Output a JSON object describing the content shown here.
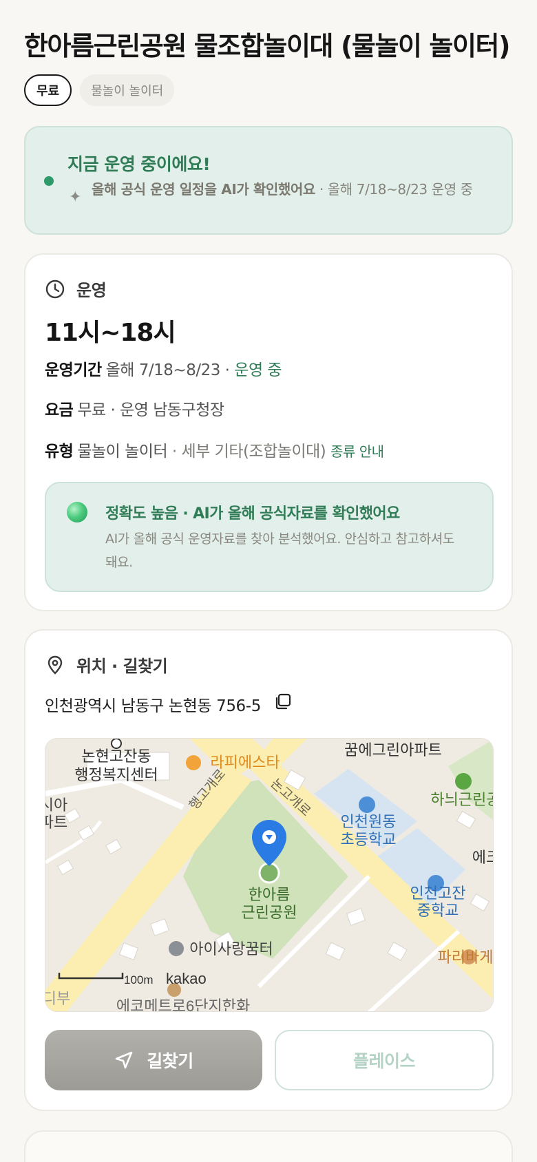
{
  "page": {
    "title": "한아름근린공원 물조합놀이대 (물놀이 놀이터)",
    "tags": [
      "무료",
      "물놀이 놀이터"
    ]
  },
  "status": {
    "title": "지금 운영 중이에요!",
    "ai_note_bold": "올해 공식 운영 일정을 AI가 확인했어요",
    "ai_note_rest": " · 올해 7/18~8/23 운영 중"
  },
  "operation": {
    "section_label": "운영",
    "hours": "11시~18시",
    "period_key": "운영기간",
    "period_value": "올해 7/18~8/23 · ",
    "period_status": "운영 중",
    "fee_key": "요금",
    "fee_value": "무료 · 운영 남동구청장",
    "type_key": "유형",
    "type_value": "물놀이 놀이터",
    "type_detail": " · 세부 기타(조합놀이대) ",
    "type_link": "종류 안내",
    "accuracy_title": "정확도 높음 · AI가 올해 공식자료를 확인했어요",
    "accuracy_desc": "AI가 올해 공식 운영자료를 찾아 분석했어요. 안심하고 참고하셔도 돼요."
  },
  "location": {
    "section_label": "위치 · 길찾기",
    "address": "인천광역시 남동구 논현동 756-5",
    "directions_button": "길찾기",
    "place_button": "플레이스",
    "map": {
      "labels": {
        "office": "논현고잔동\n행정복지센터",
        "cafe": "라피에스타",
        "apt_top": "꿈에그린아파트",
        "park_right": "하늬근린공",
        "school1": "인천원동\n초등학교",
        "school2": "인천고잔\n중학교",
        "ek": "에크",
        "park_main": "한아름\n근린공원",
        "kids": "아이사랑꿈터",
        "bakery": "파리바게",
        "road1": "행고개로",
        "road2": "논고개로",
        "apt_left": "시아\n파트",
        "apt_bottom": "에코메트로6단지한화",
        "left_bottom": "디부",
        "scale": "100m",
        "brand": "kakao"
      },
      "colors": {
        "park": "#cfe2b9",
        "road": "#fbeeb0",
        "school": "#d5e4f0",
        "pin": "#2a7be4"
      }
    }
  }
}
